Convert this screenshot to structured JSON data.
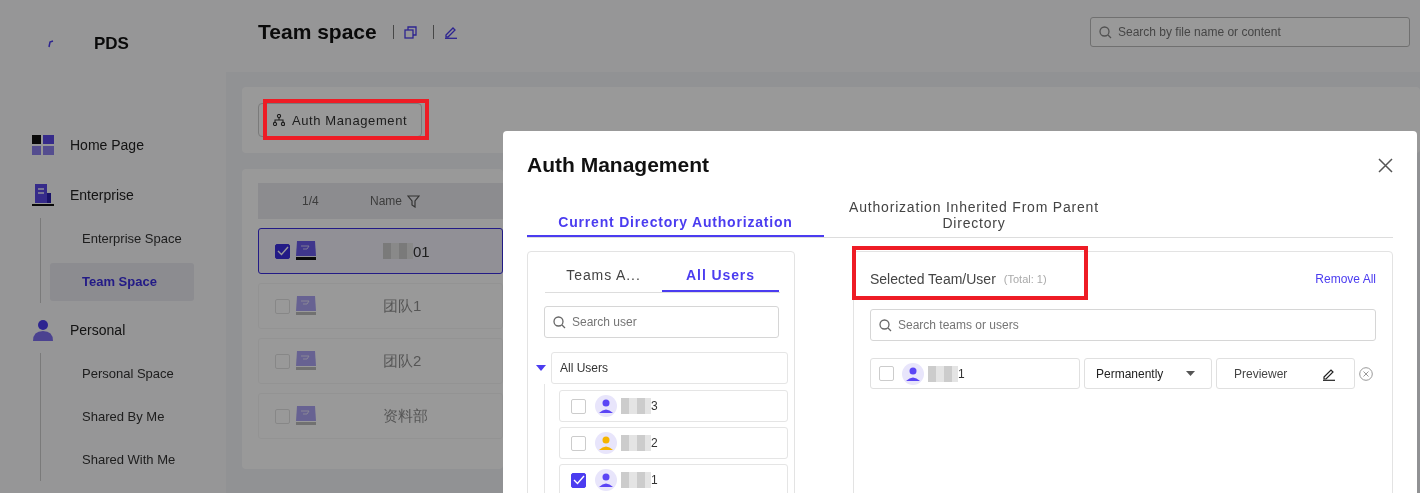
{
  "sidebar": {
    "logo_text": "PDS",
    "sections": [
      {
        "label": "Home Page"
      },
      {
        "label": "Enterprise",
        "children": [
          {
            "label": "Enterprise Space",
            "selected": false
          },
          {
            "label": "Team Space",
            "selected": true
          }
        ]
      },
      {
        "label": "Personal",
        "children": [
          {
            "label": "Personal Space",
            "selected": false
          },
          {
            "label": "Shared By Me",
            "selected": false
          },
          {
            "label": "Shared With Me",
            "selected": false
          }
        ]
      }
    ]
  },
  "header": {
    "title": "Team space",
    "search": {
      "placeholder": "Search by file name or content"
    }
  },
  "toolbar": {
    "button": "Auth Management"
  },
  "table": {
    "columns": [
      "1/4",
      "Name"
    ],
    "rows": [
      {
        "name": "01",
        "selected": true,
        "redacted": true
      },
      {
        "name": "团队1",
        "selected": false,
        "redacted": false
      },
      {
        "name": "团队2",
        "selected": false,
        "redacted": false
      },
      {
        "name": "资料部",
        "selected": false,
        "redacted": false
      }
    ]
  },
  "dialog": {
    "title": "Auth Management",
    "tabs": [
      {
        "label": "Current Directory Authorization",
        "selected": true
      },
      {
        "label": "Authorization Inherited From Parent Directory",
        "selected": false
      }
    ],
    "left": {
      "tabs": [
        {
          "label": "Teams A...",
          "selected": false
        },
        {
          "label": "All Users",
          "selected": true
        }
      ],
      "search": {
        "placeholder": "Search user"
      },
      "tree": {
        "label": "All Users",
        "expanded": true,
        "children": [
          {
            "name": "3",
            "checked": false,
            "color": "#5b45f5",
            "redacted": true
          },
          {
            "name": "2",
            "checked": false,
            "color": "#f5b400",
            "redacted": true
          },
          {
            "name": "1",
            "checked": true,
            "color": "#5b45f5",
            "redacted": true
          }
        ]
      }
    },
    "right": {
      "heading": "Selected Team/User",
      "total": "(Total: 1)",
      "remove_all": "Remove All",
      "search": {
        "placeholder": "Search teams or users"
      },
      "entries": [
        {
          "name": "1",
          "checked": false,
          "color": "#5b45f5",
          "redacted": true,
          "duration": "Permanently",
          "role": "Previewer"
        }
      ]
    }
  }
}
